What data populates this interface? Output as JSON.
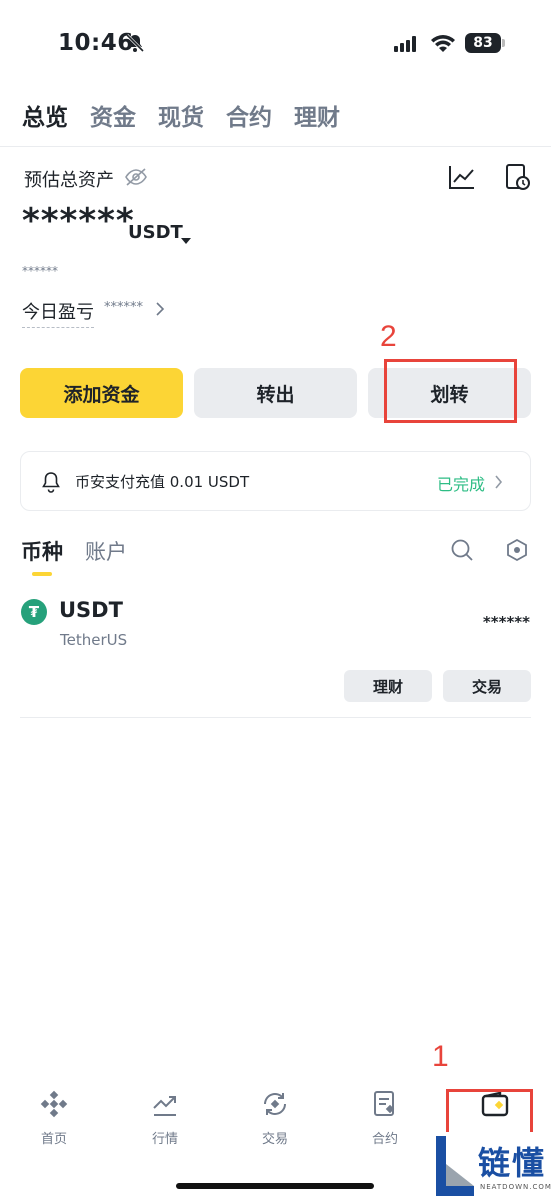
{
  "status_bar": {
    "time": "10:46",
    "battery": "83"
  },
  "tabs": [
    {
      "label": "总览"
    },
    {
      "label": "资金"
    },
    {
      "label": "现货"
    },
    {
      "label": "合约"
    },
    {
      "label": "理财"
    }
  ],
  "assets": {
    "label": "预估总资产",
    "balance": "******",
    "currency": "USDT",
    "sub_value": "******",
    "pnl_label": "今日盈亏",
    "pnl_value": "******"
  },
  "actions": {
    "deposit": "添加资金",
    "withdraw": "转出",
    "transfer": "划转"
  },
  "annotations": {
    "step1": "1",
    "step2": "2"
  },
  "notice": {
    "text": "币安支付充值 0.01 USDT",
    "status": "已完成"
  },
  "coin_tabs": {
    "coins": "币种",
    "accounts": "账户"
  },
  "coins": [
    {
      "logo": "₮",
      "symbol": "USDT",
      "name": "TetherUS",
      "amount": "******",
      "earn_label": "理财",
      "trade_label": "交易"
    }
  ],
  "bottom_nav": {
    "home": "首页",
    "markets": "行情",
    "trade": "交易",
    "futures": "合约"
  },
  "watermark": {
    "text": "链懂",
    "sub": "NEATDOWN.COM"
  },
  "colors": {
    "accent": "#fcd535",
    "success": "#2ebd85",
    "annotation": "#e8443b"
  }
}
